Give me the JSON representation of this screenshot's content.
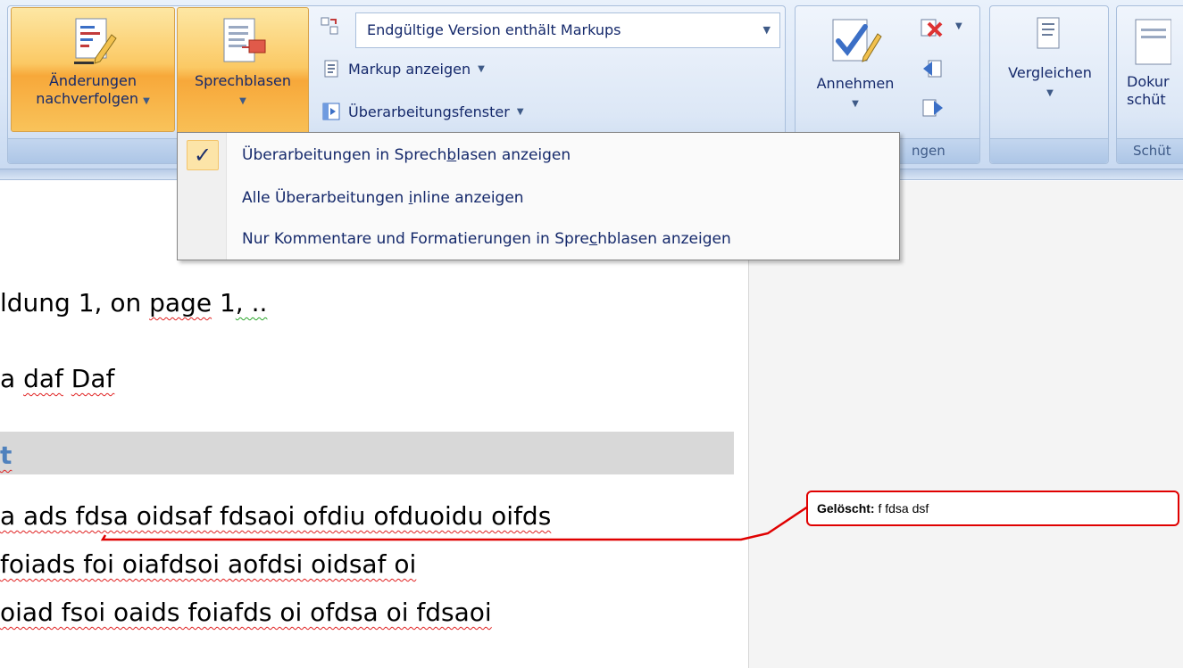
{
  "ribbon": {
    "track_changes": {
      "label_line1": "Änderungen",
      "label_line2": "nachverfolgen"
    },
    "balloons": {
      "label": "Sprechblasen"
    },
    "display_combo": {
      "value": "Endgültige Version enthält Markups"
    },
    "show_markup": {
      "label": "Markup anzeigen"
    },
    "review_pane": {
      "label": "Überarbeitungsfenster"
    },
    "accept": {
      "label": "Annehmen"
    },
    "changes_group_label": "ngen",
    "compare": {
      "label": "Vergleichen"
    },
    "protect": {
      "label_line1": "Dokur",
      "label_line2": "schüt",
      "group_label": "Schüt"
    }
  },
  "menu": {
    "items": [
      {
        "pre": "Überarbeitungen in Sprech",
        "accel": "b",
        "post": "lasen anzeigen",
        "checked": true
      },
      {
        "pre": "Alle Überarbeitungen ",
        "accel": "i",
        "post": "nline anzeigen",
        "checked": false
      },
      {
        "pre": "Nur Kommentare und Formatierungen in Spre",
        "accel": "c",
        "post": "hblasen anzeigen",
        "checked": false
      }
    ]
  },
  "document": {
    "line1": {
      "a": "ldung 1, on ",
      "b": "page",
      "c": " 1",
      "d": ", .."
    },
    "line2": {
      "a": "a ",
      "b": "daf",
      "c": " ",
      "d": "Daf"
    },
    "heading": "t",
    "line3": "a ads fdsa oidsaf fdsaoi ofdiu ofduoidu oifds",
    "line4": " foiads foi oiafdsoi aofdsi oidsaf oi",
    "line5": " oiad fsoi oaids foiafds oi ofdsa oi fdsaoi"
  },
  "balloon": {
    "label": "Gelöscht:",
    "text": " f fdsa dsf"
  },
  "colors": {
    "accent_orange": "#f7a83a",
    "ribbon_blue": "#dbe7f7",
    "balloon_red": "#e00000"
  }
}
